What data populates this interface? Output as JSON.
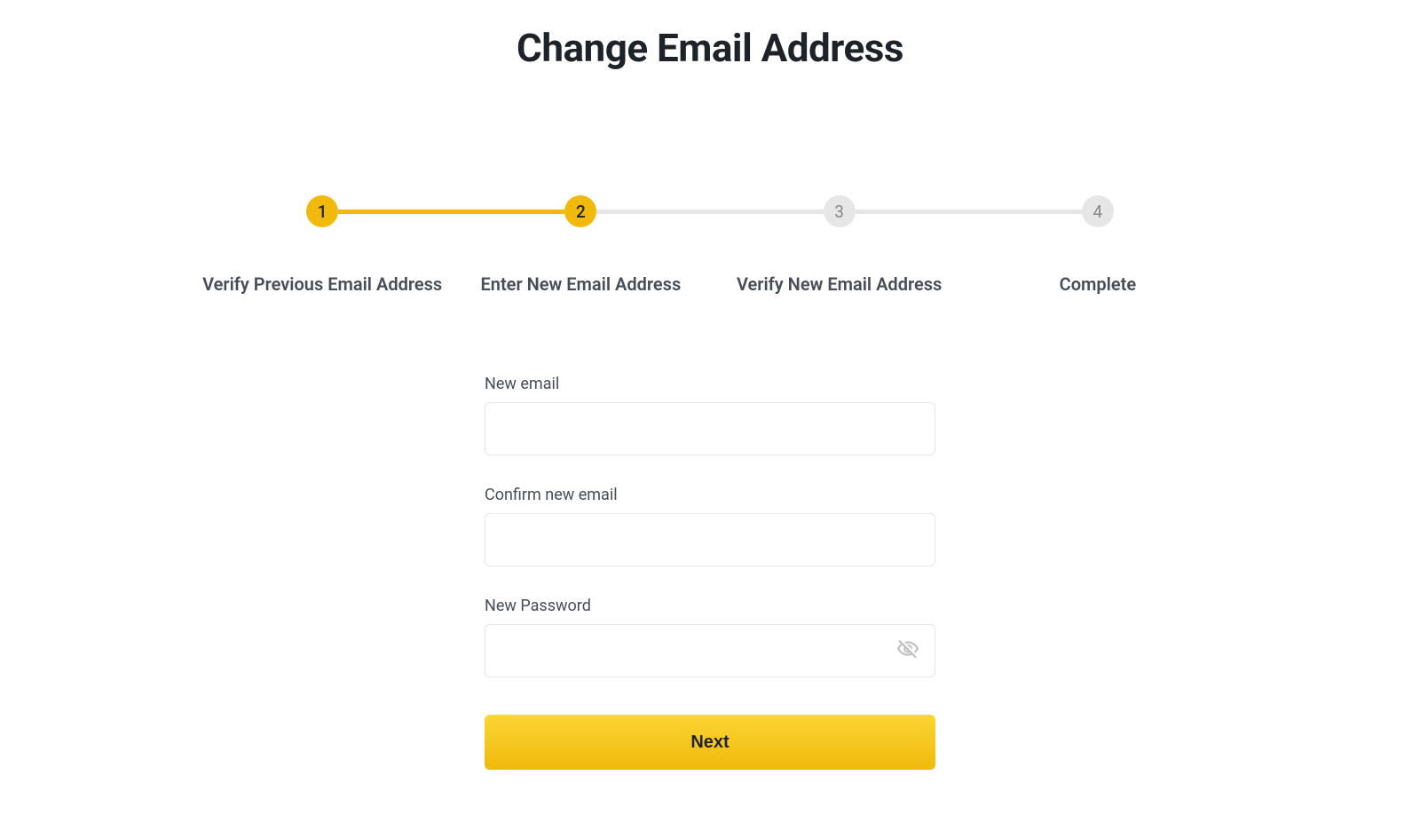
{
  "page": {
    "title": "Change Email Address"
  },
  "stepper": {
    "steps": [
      {
        "number": "1",
        "label": "Verify Previous Email Address",
        "state": "active"
      },
      {
        "number": "2",
        "label": "Enter New Email Address",
        "state": "active"
      },
      {
        "number": "3",
        "label": "Verify New Email Address",
        "state": "inactive"
      },
      {
        "number": "4",
        "label": "Complete",
        "state": "inactive"
      }
    ]
  },
  "form": {
    "new_email": {
      "label": "New email",
      "value": ""
    },
    "confirm_email": {
      "label": "Confirm new email",
      "value": ""
    },
    "new_password": {
      "label": "New Password",
      "value": ""
    },
    "submit_label": "Next"
  },
  "colors": {
    "brand": "#f0b90b",
    "inactive": "#e6e6e6",
    "text_primary": "#1e2329",
    "text_secondary": "#474d57"
  }
}
